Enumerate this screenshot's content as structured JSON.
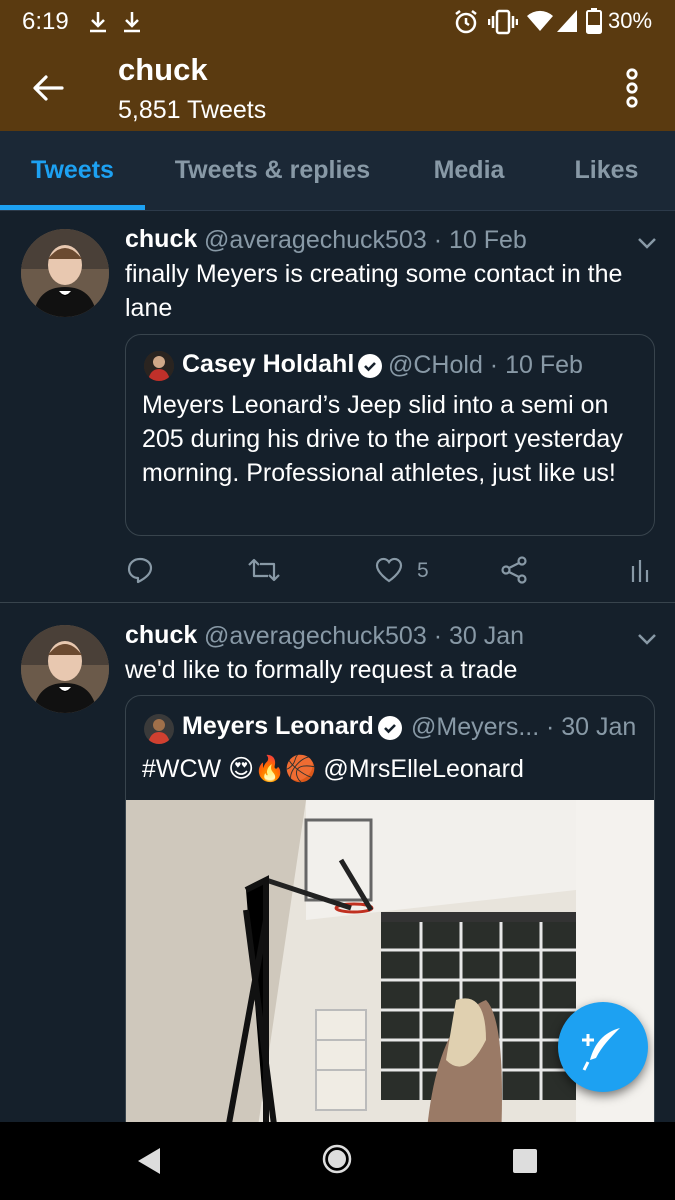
{
  "status_bar": {
    "time": "6:19",
    "battery": "30%"
  },
  "header": {
    "title": "chuck",
    "subtitle": "5,851 Tweets"
  },
  "tabs": [
    {
      "label": "Tweets",
      "active": true
    },
    {
      "label": "Tweets & replies",
      "active": false
    },
    {
      "label": "Media",
      "active": false
    },
    {
      "label": "Likes",
      "active": false
    }
  ],
  "tweets": [
    {
      "name": "chuck",
      "handle_date": "@averagechuck503 · 10 Feb",
      "text": "finally Meyers is creating some contact in the lane",
      "quote": {
        "name": "Casey Holdahl",
        "handle_date": "@CHold · 10 Feb",
        "text": "Meyers Leonard’s Jeep slid into a semi on 205 during his drive to the airport yesterday morning. Professional athletes, just like us!"
      },
      "like_count": "5"
    },
    {
      "name": "chuck",
      "handle_date": "@averagechuck503 · 30 Jan",
      "text": "we'd like to formally request a trade",
      "quote": {
        "name": "Meyers Leonard",
        "handle": "@Meyers...",
        "date": "· 30 Jan",
        "text_prefix": "#WCW",
        "emojis": "😍🔥🏀",
        "text_suffix": "@MrsElleLeonard"
      }
    }
  ],
  "colors": {
    "header_bg": "#5a3a10",
    "page_bg": "#15202b",
    "accent": "#1da1f2",
    "muted": "#8899a6"
  }
}
